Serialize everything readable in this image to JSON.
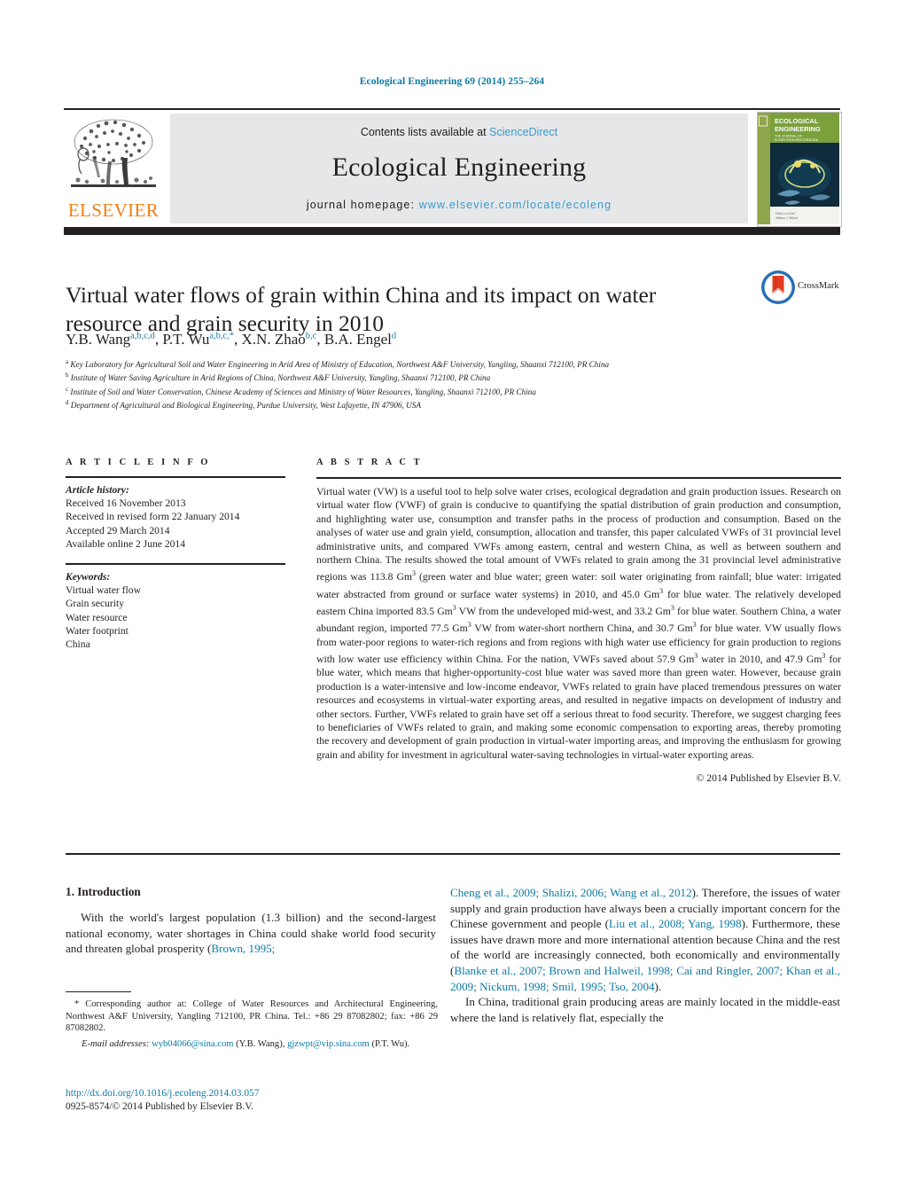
{
  "running_head": "Ecological Engineering 69 (2014) 255–264",
  "masthead": {
    "contents_prefix": "Contents lists available at ",
    "sciencedirect": "ScienceDirect",
    "journal_title": "Ecological Engineering",
    "homepage_prefix": "journal homepage: ",
    "homepage_url": "www.elsevier.com/locate/ecoleng",
    "publisher_logo_text": "ELSEVIER",
    "cover": {
      "line1": "ECOLOGICAL",
      "line2": "ENGINEERING",
      "line3": "THE JOURNAL OF",
      "line4": "ECOSYSTEM RESTORATION"
    }
  },
  "crossmark": {
    "label": "CrossMark"
  },
  "article": {
    "title": "Virtual water flows of grain within China and its impact on water resource and grain security in 2010",
    "authors": [
      {
        "name": "Y.B. Wang",
        "sup": "a,b,c,d"
      },
      {
        "name": "P.T. Wu",
        "sup": "a,b,c,*"
      },
      {
        "name": "X.N. Zhao",
        "sup": "b,c"
      },
      {
        "name": "B.A. Engel",
        "sup": "d"
      }
    ],
    "affiliations": [
      {
        "mark": "a",
        "text": "Key Laboratory for Agricultural Soil and Water Engineering in Arid Area of Ministry of Education, Northwest A&F University, Yangling, Shaanxi 712100, PR China"
      },
      {
        "mark": "b",
        "text": "Institute of Water Saving Agriculture in Arid Regions of China, Northwest A&F University, Yangling, Shaanxi 712100, PR China"
      },
      {
        "mark": "c",
        "text": "Institute of Soil and Water Conservation, Chinese Academy of Sciences and Ministry of Water Resources, Yangling, Shaanxi 712100, PR China"
      },
      {
        "mark": "d",
        "text": "Department of Agricultural and Biological Engineering, Purdue University, West Lafayette, IN 47906, USA"
      }
    ]
  },
  "article_info": {
    "heading": "A R T I C L E    I N F O",
    "history_label": "Article history:",
    "history": [
      "Received 16 November 2013",
      "Received in revised form 22 January 2014",
      "Accepted 29 March 2014",
      "Available online 2 June 2014"
    ],
    "keywords_label": "Keywords:",
    "keywords": [
      "Virtual water flow",
      "Grain security",
      "Water resource",
      "Water footprint",
      "China"
    ]
  },
  "abstract": {
    "heading": "A B S T R A C T",
    "paragraph_html": "Virtual water (VW) is a useful tool to help solve water crises, ecological degradation and grain production issues. Research on virtual water flow (VWF) of grain is conducive to quantifying the spatial distribution of grain production and consumption, and highlighting water use, consumption and transfer paths in the process of production and consumption. Based on the analyses of water use and grain yield, consumption, allocation and transfer, this paper calculated VWFs of 31 provincial level administrative units, and compared VWFs among eastern, central and western China, as well as between southern and northern China. The results showed the total amount of VWFs related to grain among the 31 provincial level administrative regions was 113.8 Gm<sup>3</sup> (green water and blue water; green water: soil water originating from rainfall; blue water: irrigated water abstracted from ground or surface water systems) in 2010, and 45.0 Gm<sup>3</sup> for blue water. The relatively developed eastern China imported 83.5 Gm<sup>3</sup> VW from the undeveloped mid-west, and 33.2 Gm<sup>3</sup> for blue water. Southern China, a water abundant region, imported 77.5 Gm<sup>3</sup> VW from water-short northern China, and 30.7 Gm<sup>3</sup> for blue water. VW usually flows from water-poor regions to water-rich regions and from regions with high water use efficiency for grain production to regions with low water use efficiency within China. For the nation, VWFs saved about 57.9 Gm<sup>3</sup> water in 2010, and 47.9 Gm<sup>3</sup> for blue water, which means that higher-opportunity-cost blue water was saved more than green water. However, because grain production is a water-intensive and low-income endeavor, VWFs related to grain have placed tremendous pressures on water resources and ecosystems in virtual-water exporting areas, and resulted in negative impacts on development of industry and other sectors. Further, VWFs related to grain have set off a serious threat to food security. Therefore, we suggest charging fees to beneficiaries of VWFs related to grain, and making some economic compensation to exporting areas, thereby promoting the recovery and development of grain production in virtual-water importing areas, and improving the enthusiasm for growing grain and ability for investment in agricultural water-saving technologies in virtual-water exporting areas.",
    "copyright": "© 2014 Published by Elsevier B.V."
  },
  "introduction": {
    "heading": "1.  Introduction",
    "left_paragraph_html": "With the world's largest population (1.3 billion) and the second-largest national economy, water shortages in China could shake world food security and threaten global prosperity (<span class=\"ref\">Brown, 1995;</span>",
    "right_paragraph1_html": "<span class=\"ref\">Cheng et al., 2009; Shalizi, 2006; Wang et al., 2012</span>). Therefore, the issues of water supply and grain production have always been a crucially important concern for the Chinese government and people (<span class=\"ref\">Liu et al., 2008; Yang, 1998</span>). Furthermore, these issues have drawn more and more international attention because China and the rest of the world are increasingly connected, both economically and environmentally (<span class=\"ref\">Blanke et al., 2007; Brown and Halweil, 1998; Cai and Ringler, 2007; Khan et al., 2009; Nickum, 1998; Smil, 1995; Tso, 2004</span>).",
    "right_paragraph2_html": "In China, traditional grain producing areas are mainly located in the middle-east where the land is relatively flat, especially the"
  },
  "footnotes": {
    "corresponding_html": "* Corresponding author at: College of Water Resources and Architectural Engineering, Northwest A&amp;F University, Yangling 712100, PR China. Tel.: +86 29 87082802; fax: +86 29 87082802.",
    "emails_html": "<span class=\"em\">E-mail addresses:</span> <span class=\"ref\">wyb04066@sina.com</span> (Y.B. Wang), <span class=\"ref\">gjzwpt@vip.sina.com</span> (P.T. Wu)."
  },
  "doi_block": {
    "doi_url": "http://dx.doi.org/10.1016/j.ecoleng.2014.03.057",
    "issn_line": "0925-8574/© 2014 Published by Elsevier B.V."
  },
  "colors": {
    "link": "#0b7aa5",
    "sciencedirect": "#3a9bcf",
    "elsevier_orange": "#f07f13",
    "band_gray": "#e6e7e8",
    "ink": "#231f20"
  }
}
